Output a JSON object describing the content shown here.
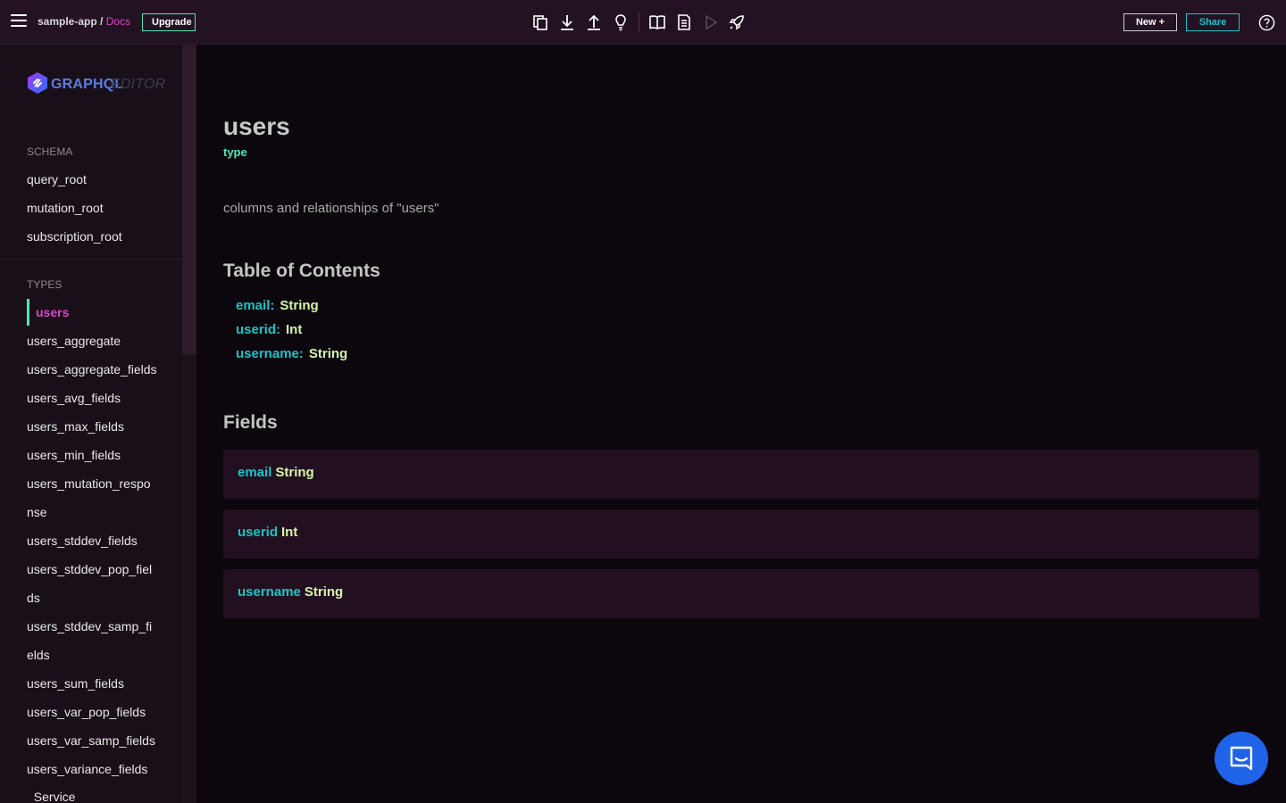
{
  "header": {
    "app_name": "sample-app",
    "separator": " / ",
    "page": "Docs",
    "upgrade_label": "Upgrade",
    "new_label": "New +",
    "share_label": "Share",
    "toolbar_icons": [
      "copy-icon",
      "download-icon",
      "upload-icon",
      "lightbulb-icon",
      "book-icon",
      "document-icon",
      "play-icon",
      "rocket-icon"
    ]
  },
  "sidebar": {
    "logo": {
      "part_a": "GRAPHQL",
      "part_b": "EDITOR"
    },
    "schema_title": "SCHEMA",
    "schema_items": [
      "query_root",
      "mutation_root",
      "subscription_root"
    ],
    "types_title": "TYPES",
    "active_type": "users",
    "type_items": [
      "users_aggregate",
      "users_aggregate_fields",
      "users_avg_fields",
      "users_max_fields",
      "users_min_fields",
      "users_mutation_respo",
      "nse",
      "users_stddev_fields",
      "users_stddev_pop_fiel",
      "ds",
      "users_stddev_samp_fi",
      "elds",
      "users_sum_fields",
      "users_var_pop_fields",
      "users_var_samp_fields",
      "users_variance_fields",
      "_Service"
    ]
  },
  "main": {
    "title": "users",
    "kind": "type",
    "description": "columns and relationships of \"users\"",
    "toc_title": "Table of Contents",
    "toc": [
      {
        "name": "email:",
        "type": "String"
      },
      {
        "name": "userid:",
        "type": "Int"
      },
      {
        "name": "username:",
        "type": "String"
      }
    ],
    "fields_title": "Fields",
    "fields": [
      {
        "name": "email",
        "type": "String"
      },
      {
        "name": "userid",
        "type": "Int"
      },
      {
        "name": "username",
        "type": "String"
      }
    ]
  },
  "colors": {
    "accent_green": "#4ee6b4",
    "accent_pink": "#d946c6",
    "field_name": "#19c3c6",
    "field_type": "#d6f5a8",
    "chat": "#1f63e8"
  }
}
